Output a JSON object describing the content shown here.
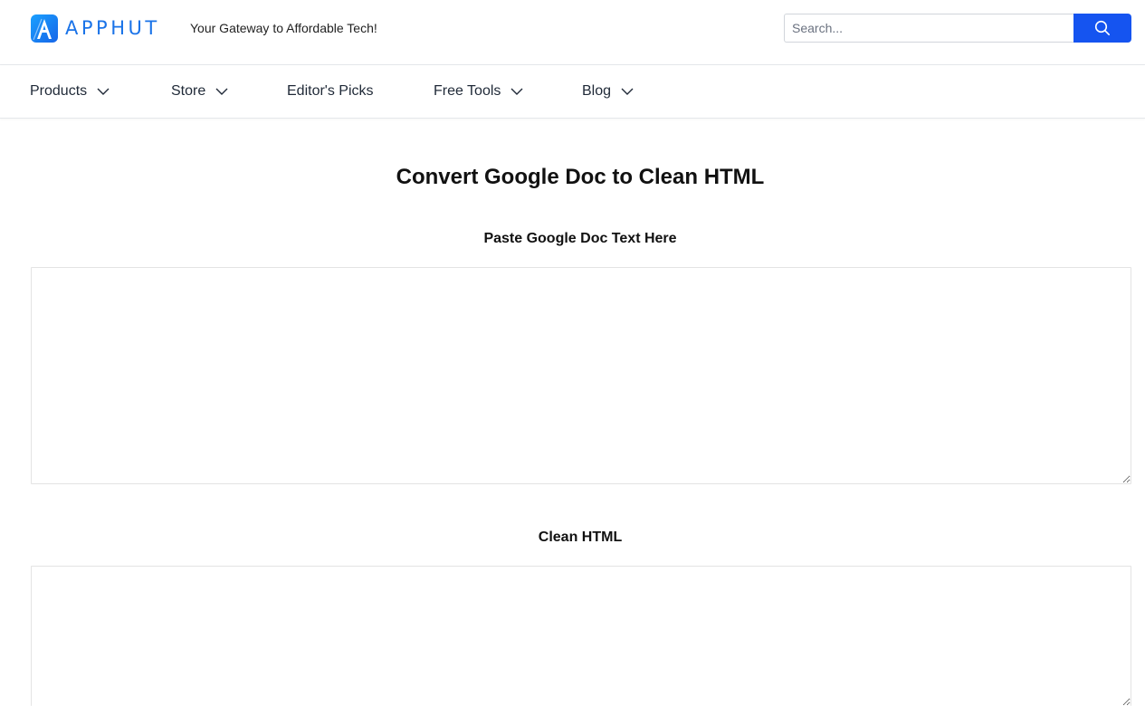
{
  "header": {
    "logo_text": "APPHUT",
    "tagline": "Your Gateway to Affordable Tech!",
    "search": {
      "placeholder": "Search...",
      "value": "",
      "button_icon": "search-icon"
    }
  },
  "nav": {
    "items": [
      {
        "label": "Products",
        "has_dropdown": true
      },
      {
        "label": "Store",
        "has_dropdown": true
      },
      {
        "label": "Editor's Picks",
        "has_dropdown": false
      },
      {
        "label": "Free Tools",
        "has_dropdown": true
      },
      {
        "label": "Blog",
        "has_dropdown": true
      }
    ]
  },
  "main": {
    "title": "Convert Google Doc to Clean HTML",
    "input_section": {
      "label": "Paste Google Doc Text Here",
      "value": ""
    },
    "output_section": {
      "label": "Clean HTML",
      "value": ""
    }
  },
  "colors": {
    "accent": "#1554f0",
    "logo": "#1a73e8",
    "border": "#e5e7eb"
  }
}
